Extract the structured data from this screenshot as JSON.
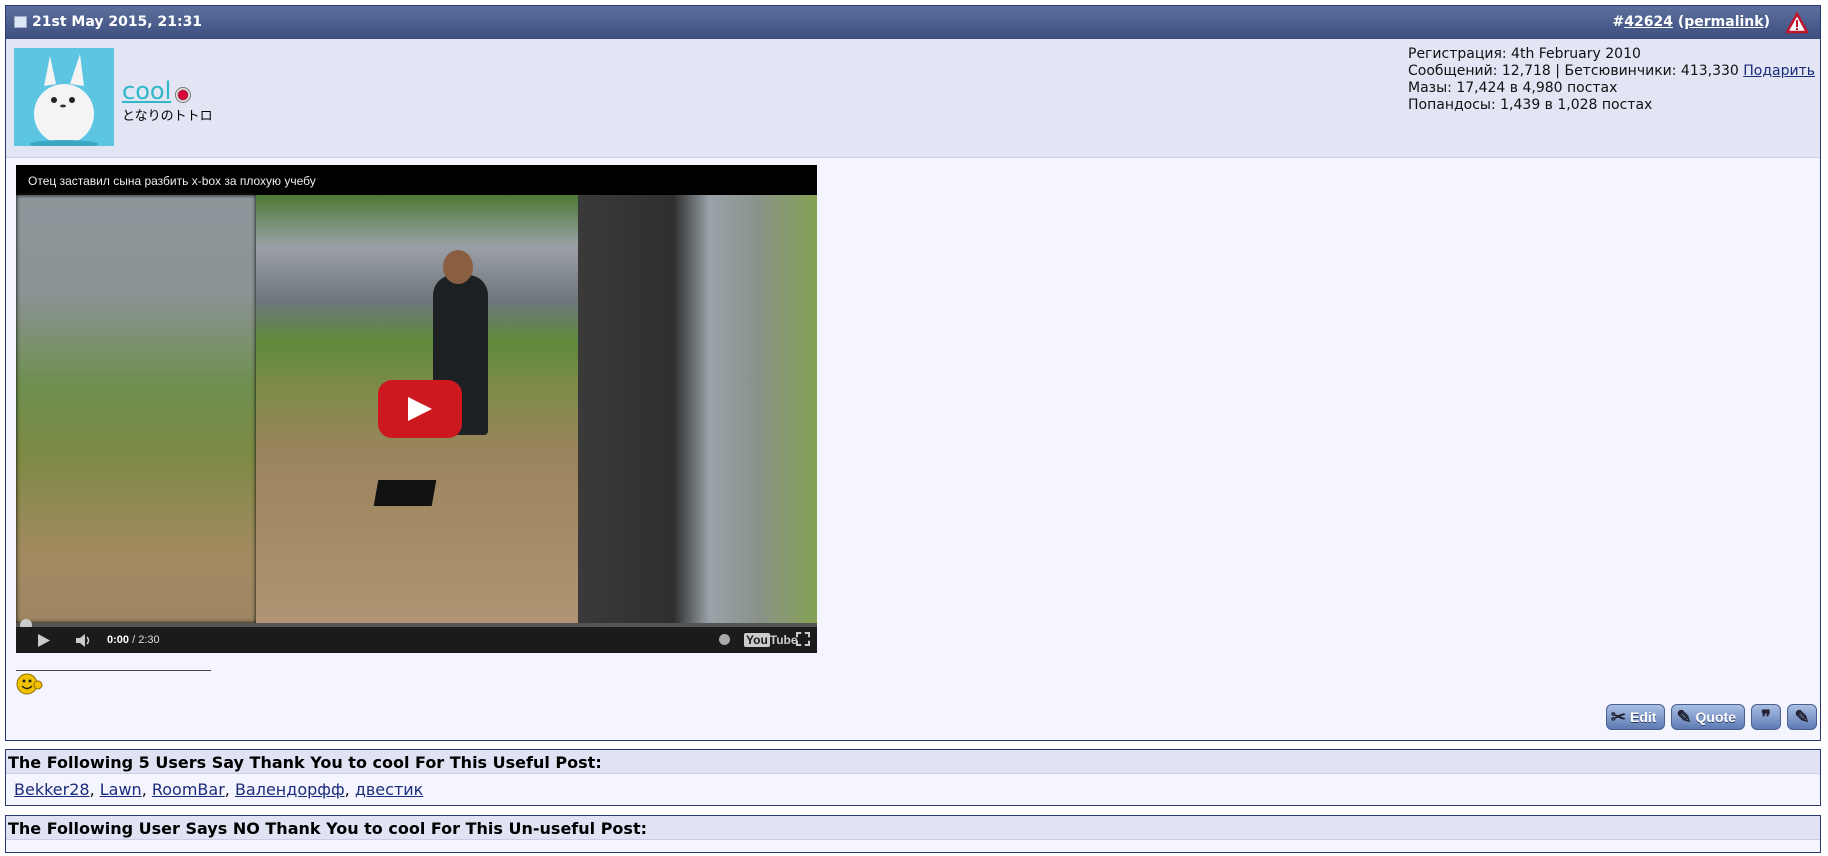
{
  "post": {
    "date": "21st May 2015, 21:31",
    "number_prefix": "#",
    "number": "42624",
    "permalink_open": " (",
    "permalink": "permalink",
    "permalink_close": ")"
  },
  "user": {
    "name": "cool",
    "title": "となりのトトロ",
    "stats": {
      "registration": "Регистрация: 4th February 2010",
      "messages": "Сообщений: 12,718 | Бетсювинчики: 413,330 ",
      "gift_link": "Подарить",
      "mazy": "Мазы: 17,424 в 4,980 постах",
      "popandosy": "Попандосы: 1,439 в 1,028 постах"
    }
  },
  "video": {
    "title": "Отец заставил сына разбить x-box за плохую учебу",
    "time_current": "0:00",
    "time_total": " / 2:30",
    "brand_you": "You",
    "brand_tube": "Tube"
  },
  "signature": {
    "line": "________________"
  },
  "buttons": {
    "edit": "Edit",
    "quote": "Quote"
  },
  "thanks": {
    "header": "The Following 5 Users Say Thank You to cool For This Useful Post:",
    "users": [
      "Bekker28",
      "Lawn",
      "RoomBar",
      "Валендорфф",
      "двестик"
    ]
  },
  "no_thanks": {
    "header": "The Following User Says NO Thank You to cool For This Un-useful Post:"
  },
  "colors": {
    "header_bar": "#3d4f80",
    "username": "#2fb8c8",
    "youtube_red": "#cc181e"
  }
}
